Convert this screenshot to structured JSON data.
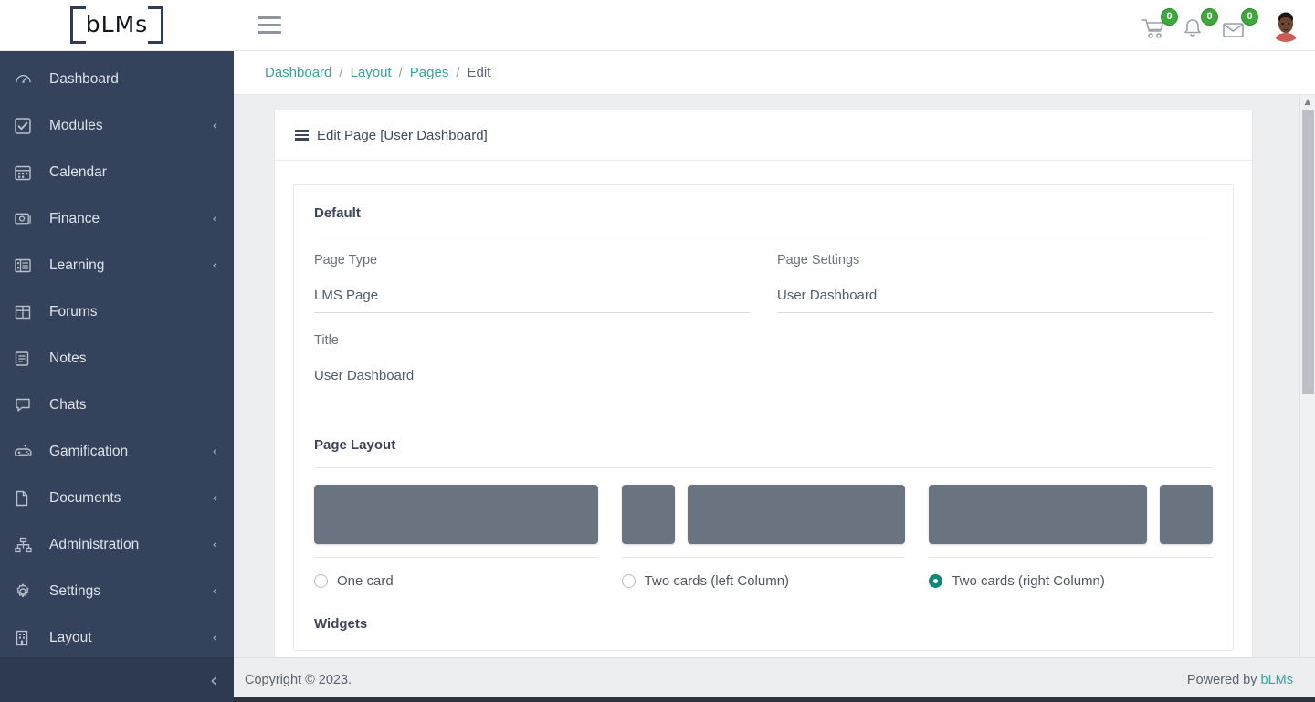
{
  "header": {
    "logo_text": "bLMs",
    "menu_icon": "hamburger-icon",
    "cart_badge": "0",
    "bell_badge": "0",
    "mail_badge": "0"
  },
  "sidebar": {
    "items": [
      {
        "label": "Dashboard",
        "icon": "speedometer-icon",
        "chevron": ""
      },
      {
        "label": "Modules",
        "icon": "checkbox-icon",
        "chevron": "‹"
      },
      {
        "label": "Calendar",
        "icon": "calendar-icon",
        "chevron": ""
      },
      {
        "label": "Finance",
        "icon": "cash-icon",
        "chevron": "‹"
      },
      {
        "label": "Learning",
        "icon": "list-grid-icon",
        "chevron": "‹"
      },
      {
        "label": "Forums",
        "icon": "table-icon",
        "chevron": ""
      },
      {
        "label": "Notes",
        "icon": "notes-icon",
        "chevron": ""
      },
      {
        "label": "Chats",
        "icon": "chat-bubble-icon",
        "chevron": ""
      },
      {
        "label": "Gamification",
        "icon": "gamepad-icon",
        "chevron": "‹"
      },
      {
        "label": "Documents",
        "icon": "document-icon",
        "chevron": "‹"
      },
      {
        "label": "Administration",
        "icon": "sitemap-icon",
        "chevron": "‹"
      },
      {
        "label": "Settings",
        "icon": "gear-icon",
        "chevron": "‹"
      },
      {
        "label": "Layout",
        "icon": "building-icon",
        "chevron": "‹"
      }
    ],
    "collapse_icon": "‹"
  },
  "breadcrumb": {
    "items": [
      "Dashboard",
      "Layout",
      "Pages"
    ],
    "current": "Edit",
    "separator": "/"
  },
  "panel": {
    "title": "Edit Page [User Dashboard]"
  },
  "form": {
    "default_section_title": "Default",
    "page_type_label": "Page Type",
    "page_type_value": "LMS Page",
    "page_settings_label": "Page Settings",
    "page_settings_value": "User Dashboard",
    "title_label": "Title",
    "title_value": "User Dashboard",
    "layout_section_title": "Page Layout",
    "widgets_section_title": "Widgets"
  },
  "layout_options": [
    {
      "label": "One card",
      "selected": false,
      "boxes": [
        "wide"
      ]
    },
    {
      "label": "Two cards (left Column)",
      "selected": false,
      "boxes": [
        "narrow",
        "wide"
      ]
    },
    {
      "label": "Two cards (right Column)",
      "selected": true,
      "boxes": [
        "wide",
        "narrow"
      ]
    }
  ],
  "footer": {
    "copyright": "Copyright © 2023.",
    "powered_prefix": "Powered by ",
    "powered_brand": "bLMs"
  },
  "colors": {
    "sidebar": "#35425c",
    "accent_teal": "#3aa396",
    "radio_selected": "#0f8a78",
    "badge_green": "#3ea83e",
    "preview_box": "#6a7380"
  }
}
